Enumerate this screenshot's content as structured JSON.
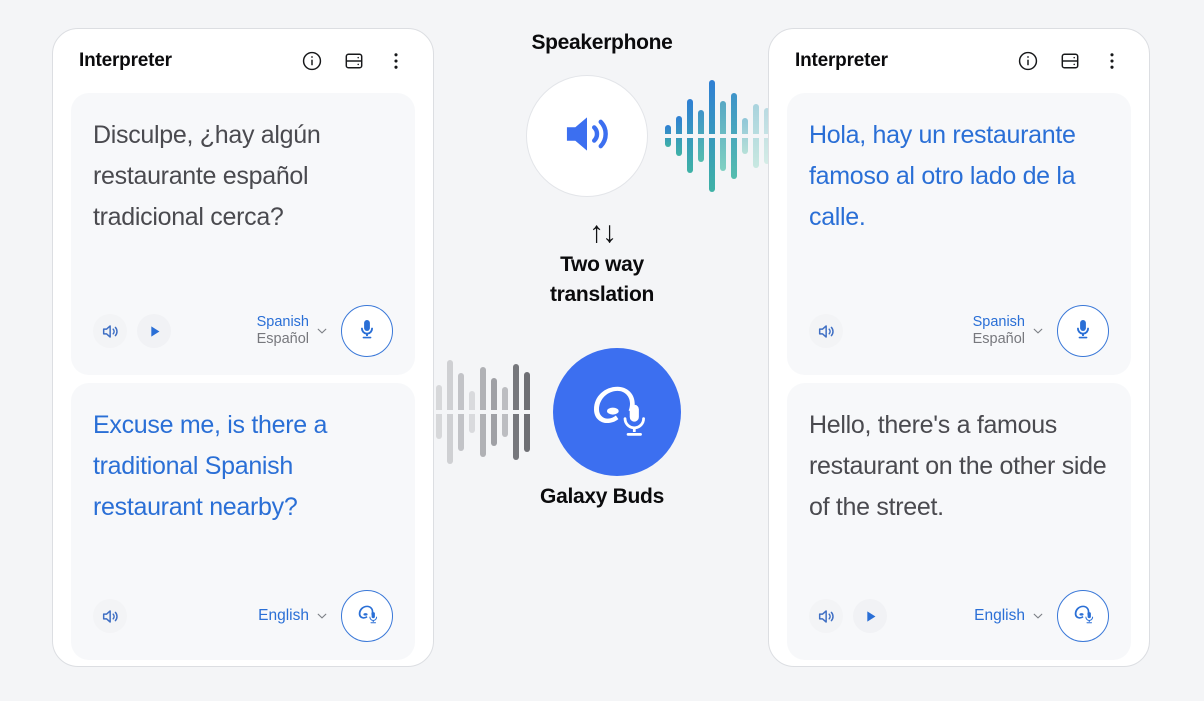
{
  "theme": {
    "page_bg": "#f4f5f7",
    "card_bg": "#f7f8fa",
    "accent_blue": "#2a6fd6",
    "buds_blue": "#3c6ff0",
    "text_dark": "#4a4a4f"
  },
  "left_panel": {
    "header": {
      "title": "Interpreter",
      "icons": [
        "info-icon",
        "save-icon",
        "more-options-icon"
      ]
    },
    "top_card": {
      "text": "Disculpe, ¿hay algún restaurante español tradicional cerca?",
      "text_color": "dark",
      "has_speaker": true,
      "has_play": true,
      "language_primary": "Spanish",
      "language_secondary": "Español",
      "action_icon": "microphone-icon"
    },
    "bottom_card": {
      "text": "Excuse me, is there a traditional Spanish restaurant nearby?",
      "text_color": "blue",
      "has_speaker": true,
      "has_play": false,
      "language_primary": "English",
      "language_secondary": "",
      "action_icon": "galaxy-buds-icon"
    }
  },
  "right_panel": {
    "header": {
      "title": "Interpreter",
      "icons": [
        "info-icon",
        "save-icon",
        "more-options-icon"
      ]
    },
    "top_card": {
      "text": "Hola, hay un restaurante famoso al otro lado de la calle.",
      "text_color": "blue",
      "has_speaker": true,
      "has_play": false,
      "language_primary": "Spanish",
      "language_secondary": "Español",
      "action_icon": "microphone-icon"
    },
    "bottom_card": {
      "text": "Hello, there's a famous restaurant on the other side of the street.",
      "text_color": "dark",
      "has_speaker": true,
      "has_play": true,
      "language_primary": "English",
      "language_secondary": "",
      "action_icon": "galaxy-buds-icon"
    }
  },
  "center": {
    "speakerphone_label": "Speakerphone",
    "speakerphone_icon": "speaker-volume-icon",
    "two_way_arrows": "↑↓",
    "two_way_line1": "Two way",
    "two_way_line2": "translation",
    "buds_label": "Galaxy Buds",
    "buds_icon": "galaxy-buds-icon",
    "waveform_right_heights": [
      22,
      40,
      74,
      52,
      112,
      70,
      86,
      36,
      64,
      56
    ],
    "waveform_left_heights": [
      54,
      104,
      78,
      42,
      90,
      68,
      50,
      96,
      80
    ]
  }
}
